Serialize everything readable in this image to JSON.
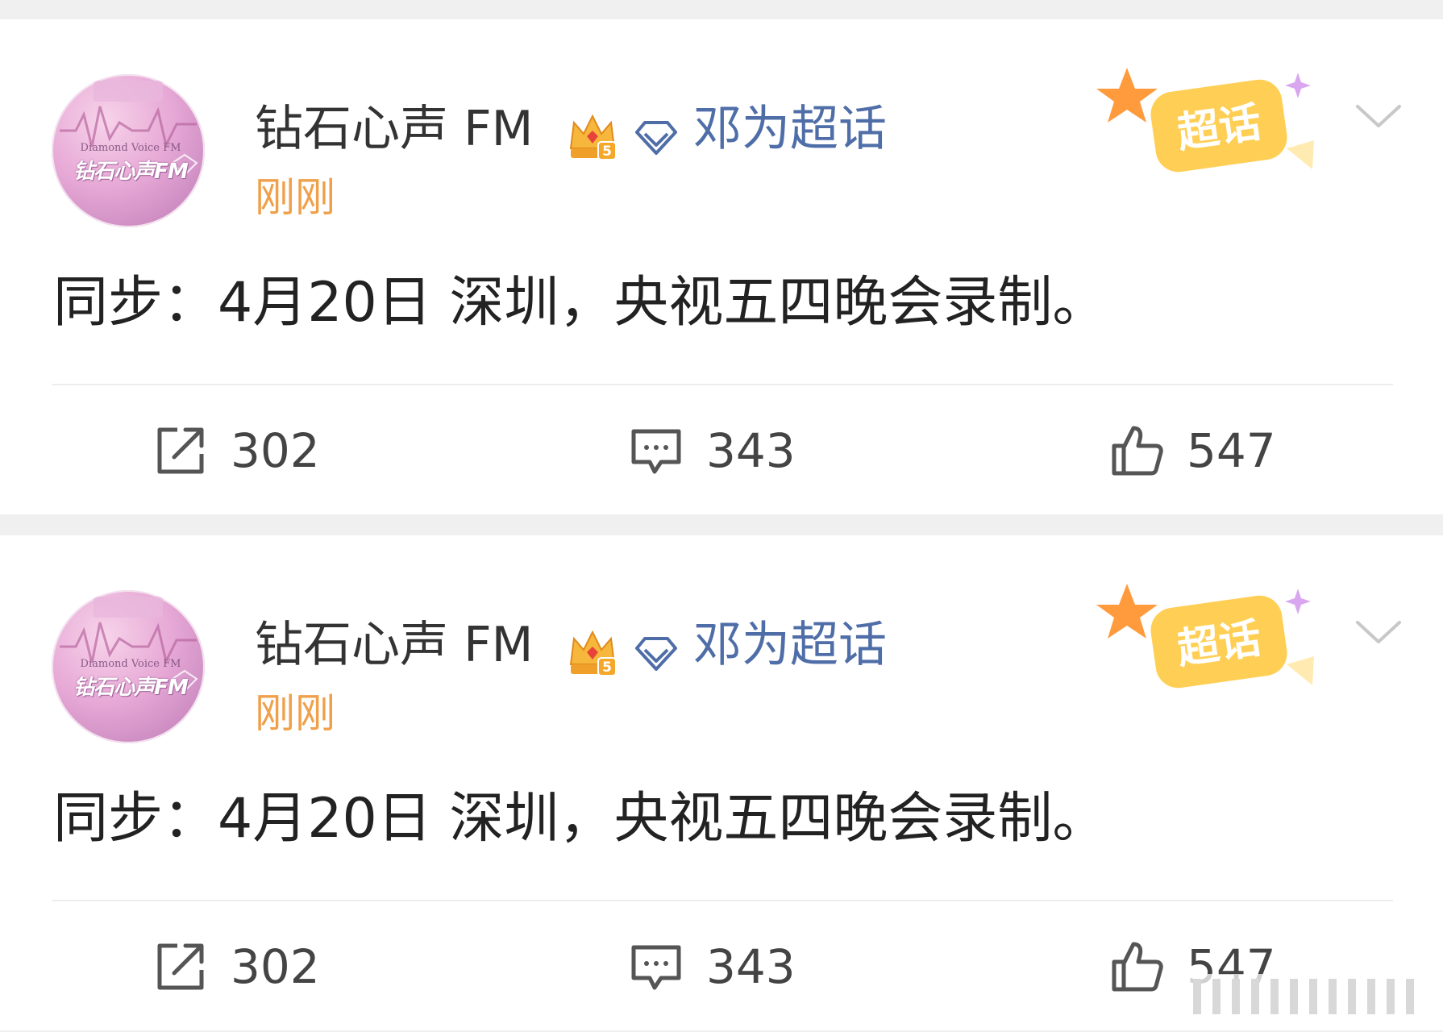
{
  "colors": {
    "page_bg": "#f0f0f0",
    "card_bg": "#ffffff",
    "name": "#333333",
    "topic_link": "#4f6ea8",
    "time": "#f0a04a",
    "content": "#222222",
    "action": "#444444"
  },
  "posts": [
    {
      "avatar": {
        "en": "Diamond Voice FM",
        "cn": "钻石心声FM"
      },
      "author": "钻石心声 FM",
      "badge_icon": "crown-level-icon",
      "topic_icon": "diamond-icon",
      "topic": "邓为超话",
      "time": "刚刚",
      "supertopic_badge": "超话",
      "content": "同步：4月20日 深圳，央视五四晚会录制。",
      "repost_count": "302",
      "comment_count": "343",
      "like_count": "547"
    },
    {
      "avatar": {
        "en": "Diamond Voice FM",
        "cn": "钻石心声FM"
      },
      "author": "钻石心声 FM",
      "badge_icon": "crown-level-icon",
      "topic_icon": "diamond-icon",
      "topic": "邓为超话",
      "time": "刚刚",
      "supertopic_badge": "超话",
      "content": "同步：4月20日 深圳，央视五四晚会录制。",
      "repost_count": "302",
      "comment_count": "343",
      "like_count": "547"
    }
  ]
}
